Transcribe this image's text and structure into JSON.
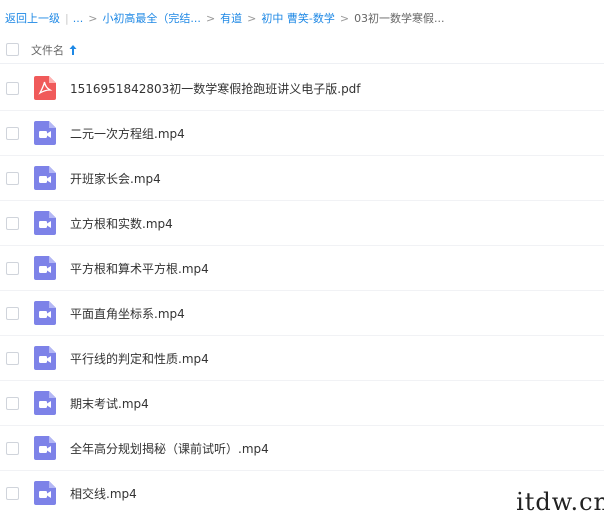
{
  "breadcrumb": {
    "back": "返回上一级",
    "ellipsis": "...",
    "items": [
      "小初高最全（完结...",
      "有道",
      "初中 曹笑-数学"
    ],
    "current": "03初一数学寒假..."
  },
  "header": {
    "column_name": "文件名"
  },
  "files": [
    {
      "name": "1516951842803初一数学寒假抢跑班讲义电子版.pdf",
      "type": "pdf"
    },
    {
      "name": "二元一次方程组.mp4",
      "type": "video"
    },
    {
      "name": "开班家长会.mp4",
      "type": "video"
    },
    {
      "name": "立方根和实数.mp4",
      "type": "video"
    },
    {
      "name": "平方根和算术平方根.mp4",
      "type": "video"
    },
    {
      "name": "平面直角坐标系.mp4",
      "type": "video"
    },
    {
      "name": "平行线的判定和性质.mp4",
      "type": "video"
    },
    {
      "name": "期末考试.mp4",
      "type": "video"
    },
    {
      "name": "全年高分规划揭秘（课前试听）.mp4",
      "type": "video"
    },
    {
      "name": "相交线.mp4",
      "type": "video"
    }
  ],
  "watermark": "itdw.cn",
  "colors": {
    "link": "#1e88e5",
    "pdf_icon": "#f05a5a",
    "video_icon": "#7d82e8"
  }
}
